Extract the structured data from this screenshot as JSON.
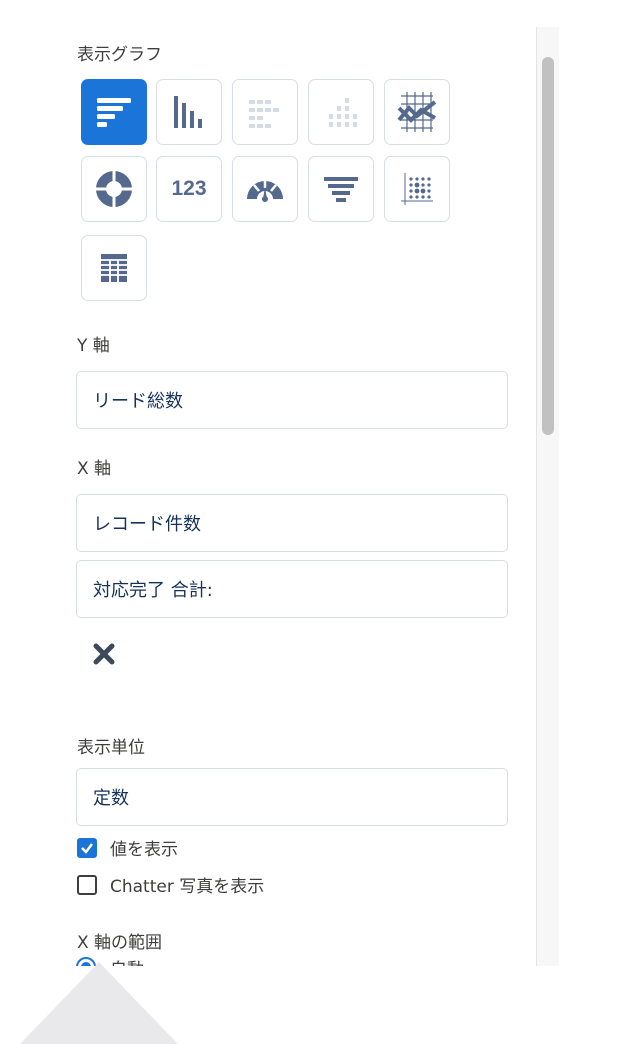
{
  "chart_type_section": {
    "label": "表示グラフ",
    "counter_icon_text": "123",
    "buttons": [
      {
        "name": "horizontal-bar-chart-icon",
        "state": "selected"
      },
      {
        "name": "vertical-bar-chart-icon",
        "state": "normal"
      },
      {
        "name": "stacked-horizontal-bar-icon",
        "state": "disabled"
      },
      {
        "name": "stacked-vertical-bar-icon",
        "state": "disabled"
      },
      {
        "name": "line-chart-icon",
        "state": "normal"
      },
      {
        "name": "donut-chart-icon",
        "state": "normal"
      },
      {
        "name": "metric-icon",
        "state": "normal"
      },
      {
        "name": "gauge-icon",
        "state": "normal"
      },
      {
        "name": "funnel-icon",
        "state": "normal"
      },
      {
        "name": "scatter-chart-icon",
        "state": "normal"
      },
      {
        "name": "table-icon",
        "state": "normal"
      }
    ]
  },
  "y_axis": {
    "label": "Y 軸",
    "value": "リード総数"
  },
  "x_axis": {
    "label": "X 軸",
    "value1": "レコード件数",
    "value2": "対応完了 合計:"
  },
  "display_unit": {
    "label": "表示単位",
    "value": "定数"
  },
  "options": {
    "show_values": "値を表示",
    "show_values_checked": true,
    "show_chatter": "Chatter 写真を表示",
    "show_chatter_checked": false
  },
  "x_range": {
    "label": "X 軸の範囲",
    "auto_option": "自動"
  },
  "colors": {
    "accent": "#1b74d8",
    "icon": "#54698d",
    "border": "#d8dde6"
  }
}
